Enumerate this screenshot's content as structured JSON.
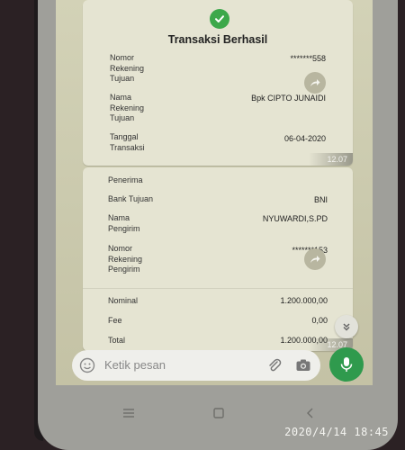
{
  "receipt_1": {
    "title": "Transaksi Berhasil",
    "rows": [
      {
        "label": "Nomor\nRekening\nTujuan",
        "value": "*******558"
      },
      {
        "label": "Nama\nRekening\nTujuan",
        "value": "Bpk CIPTO JUNAIDI"
      },
      {
        "label": "Tanggal\nTransaksi",
        "value": "06-04-2020"
      }
    ],
    "time": "12.07"
  },
  "receipt_2": {
    "section_label": "Penerima",
    "rows": [
      {
        "label": "Bank Tujuan",
        "value": "BNI"
      },
      {
        "label": "Nama\nPengirim",
        "value": "NYUWARDI,S.PD"
      },
      {
        "label": "Nomor\nRekening\nPengirim",
        "value": "*******153"
      },
      {
        "label": "Nominal",
        "value": "1.200.000,00"
      },
      {
        "label": "Fee",
        "value": "0,00"
      },
      {
        "label": "Total",
        "value": "1.200.000,00"
      }
    ],
    "time": "12.07"
  },
  "composer": {
    "placeholder": "Ketik pesan"
  },
  "photo_timestamp": "2020/4/14  18:45",
  "colors": {
    "accent_green": "#2f9a4d",
    "check_green": "#3ca84a",
    "bubble_bg": "#e5e4d2",
    "chat_bg": "#cfcdb0"
  },
  "icons": {
    "check": "check-icon",
    "forward": "forward-icon",
    "scroll": "chevron-double-down-icon",
    "emoji": "emoji-icon",
    "attach": "paperclip-icon",
    "camera": "camera-icon",
    "mic": "mic-icon",
    "nav_menu": "menu-icon",
    "nav_home": "home-icon",
    "nav_back": "back-icon"
  }
}
